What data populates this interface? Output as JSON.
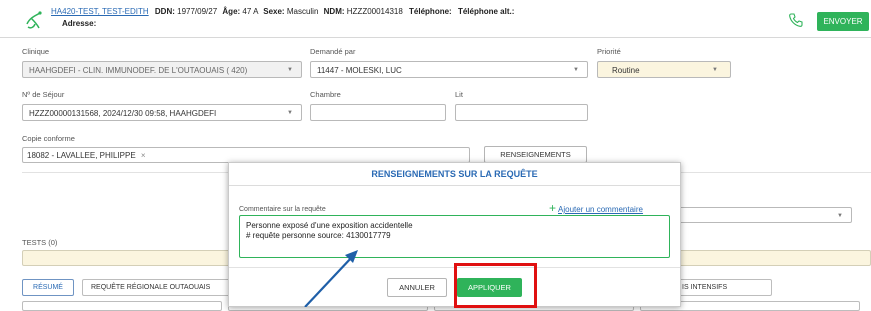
{
  "patient": {
    "name": "HA420-TEST, TEST-EDITH",
    "ddn_label": "DDN:",
    "ddn": "1977/09/27",
    "age_label": "Âge:",
    "age": "47 A",
    "sex_label": "Sexe:",
    "sex": "Masculin",
    "ndm_label": "NDM:",
    "ndm": "HZZZ00014318",
    "phone_label": "Téléphone:",
    "alt_phone_label": "Téléphone alt.:",
    "address_label": "Adresse:"
  },
  "header": {
    "send_label": "ENVOYER"
  },
  "form": {
    "clinic_label": "Clinique",
    "clinic_value": "HAAHGDEFI - CLIN. IMMUNODEF. DE L'OUTAOUAIS ( 420)",
    "requested_by_label": "Demandé par",
    "requested_by_value": "11447 - MOLESKI, LUC",
    "priority_label": "Priorité",
    "priority_value": "Routine",
    "stay_label": "Nº de Séjour",
    "stay_value": "HZZZ00000131568, 2024/12/30 09:58, HAAHGDEFI",
    "room_label": "Chambre",
    "bed_label": "Lit",
    "cc_label": "Copie conforme",
    "cc_chip": "18082 - LAVALLEE, PHILIPPE",
    "cc_chip_remove": "×",
    "info_button": "RENSEIGNEMENTS",
    "tests_label": "TESTS (0)"
  },
  "tabs": {
    "summary": "RÉSUMÉ",
    "regional": "REQUÊTE RÉGIONALE OUTAOUAIS",
    "intensive": "IS INTENSIFS"
  },
  "modal": {
    "title": "RENSEIGNEMENTS SUR LA REQUÊTE",
    "comment_label": "Commentaire sur la requête",
    "add_comment": "Ajouter un commentaire",
    "add_comment_icon": "+",
    "comment_line1": "Personne exposé d'une exposition accidentelle",
    "comment_line2": "# requête personne source: 4130017779",
    "cancel": "ANNULER",
    "apply": "APPLIQUER"
  },
  "colors": {
    "accent_green": "#2fb35a",
    "link_blue": "#2a6ab4",
    "highlight_red": "#e01010",
    "priority_bg": "#fbf5df"
  }
}
